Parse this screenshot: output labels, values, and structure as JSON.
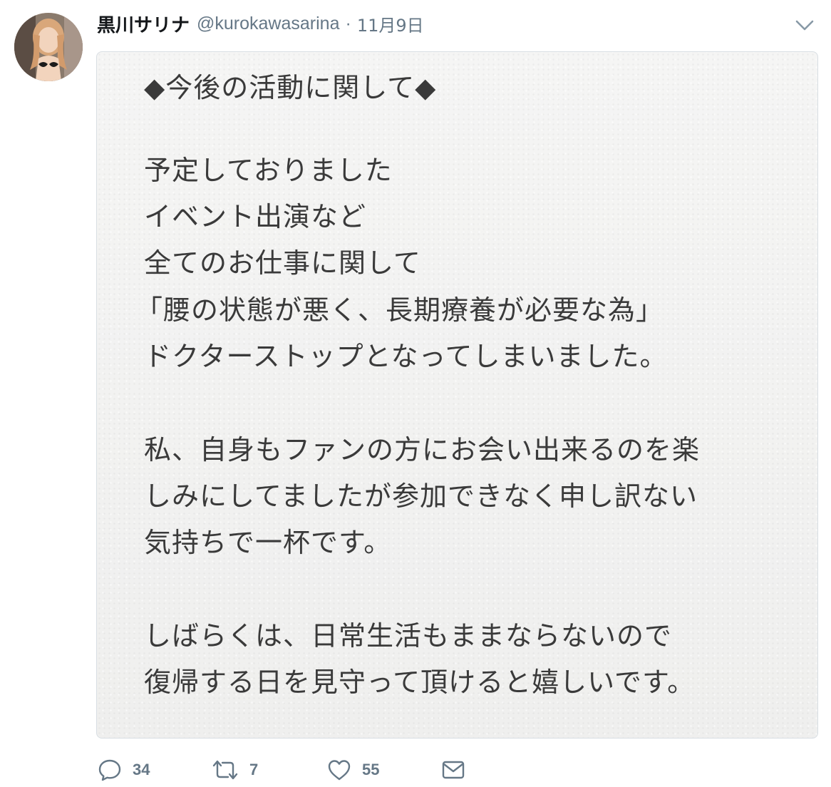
{
  "tweet": {
    "display_name": "黒川サリナ",
    "handle": "@kurokawasarina",
    "separator": "·",
    "timestamp": "11月9日",
    "media_text": [
      "◆今後の活動に関して◆",
      "予定しておりました",
      "イベント出演など",
      "全てのお仕事に関して",
      "「腰の状態が悪く、長期療養が必要な為」",
      "ドクターストップとなってしまいました。",
      "私、自身もファンの方にお会い出来るのを楽",
      "しみにしてましたが参加できなく申し訳ない",
      "気持ちで一杯です。",
      "しばらくは、日常生活もままならないので",
      "復帰する日を見守って頂けると嬉しいです。"
    ]
  },
  "actions": {
    "reply_count": "34",
    "retweet_count": "7",
    "like_count": "55"
  },
  "icons": {
    "reply": "reply-icon",
    "retweet": "retweet-icon",
    "like": "heart-icon",
    "dm": "envelope-icon",
    "menu": "chevron-down-icon"
  },
  "colors": {
    "text_primary": "#14171a",
    "text_secondary": "#657786",
    "media_border": "#d8dee3",
    "media_bg": "#f3f3f2",
    "media_text": "#3a3a3a"
  }
}
